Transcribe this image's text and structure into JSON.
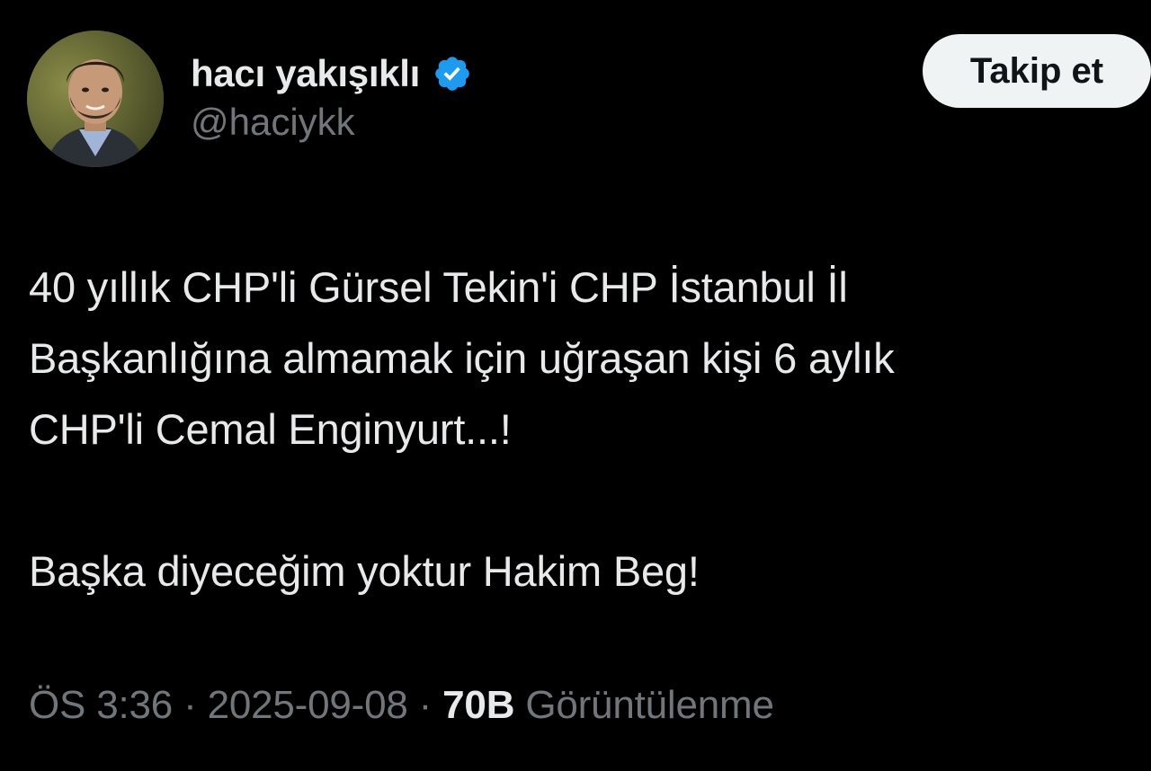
{
  "author": {
    "display_name": "hacı yakışıklı",
    "handle": "@haciykk",
    "verified_icon": "verified-badge-icon",
    "avatar_icon": "profile-avatar"
  },
  "follow_button": {
    "label": "Takip et"
  },
  "tweet": {
    "lines": [
      "40 yıllık CHP'li Gürsel Tekin'i CHP İstanbul İl",
      "Başkanlığına almamak için uğraşan kişi 6 aylık",
      "CHP'li Cemal Enginyurt...!",
      "",
      "Başka diyeceğim yoktur Hakim Beg!"
    ]
  },
  "meta": {
    "time": "ÖS 3:36",
    "separator": " · ",
    "date": "2025-09-08",
    "views_count": "70B",
    "views_label": "Görüntülenme"
  },
  "colors": {
    "background": "#000000",
    "text_primary": "#e7e9ea",
    "text_secondary": "#71767b",
    "verified_blue": "#1d9bf0",
    "button_bg": "#eff3f4",
    "button_text": "#0f1419"
  }
}
